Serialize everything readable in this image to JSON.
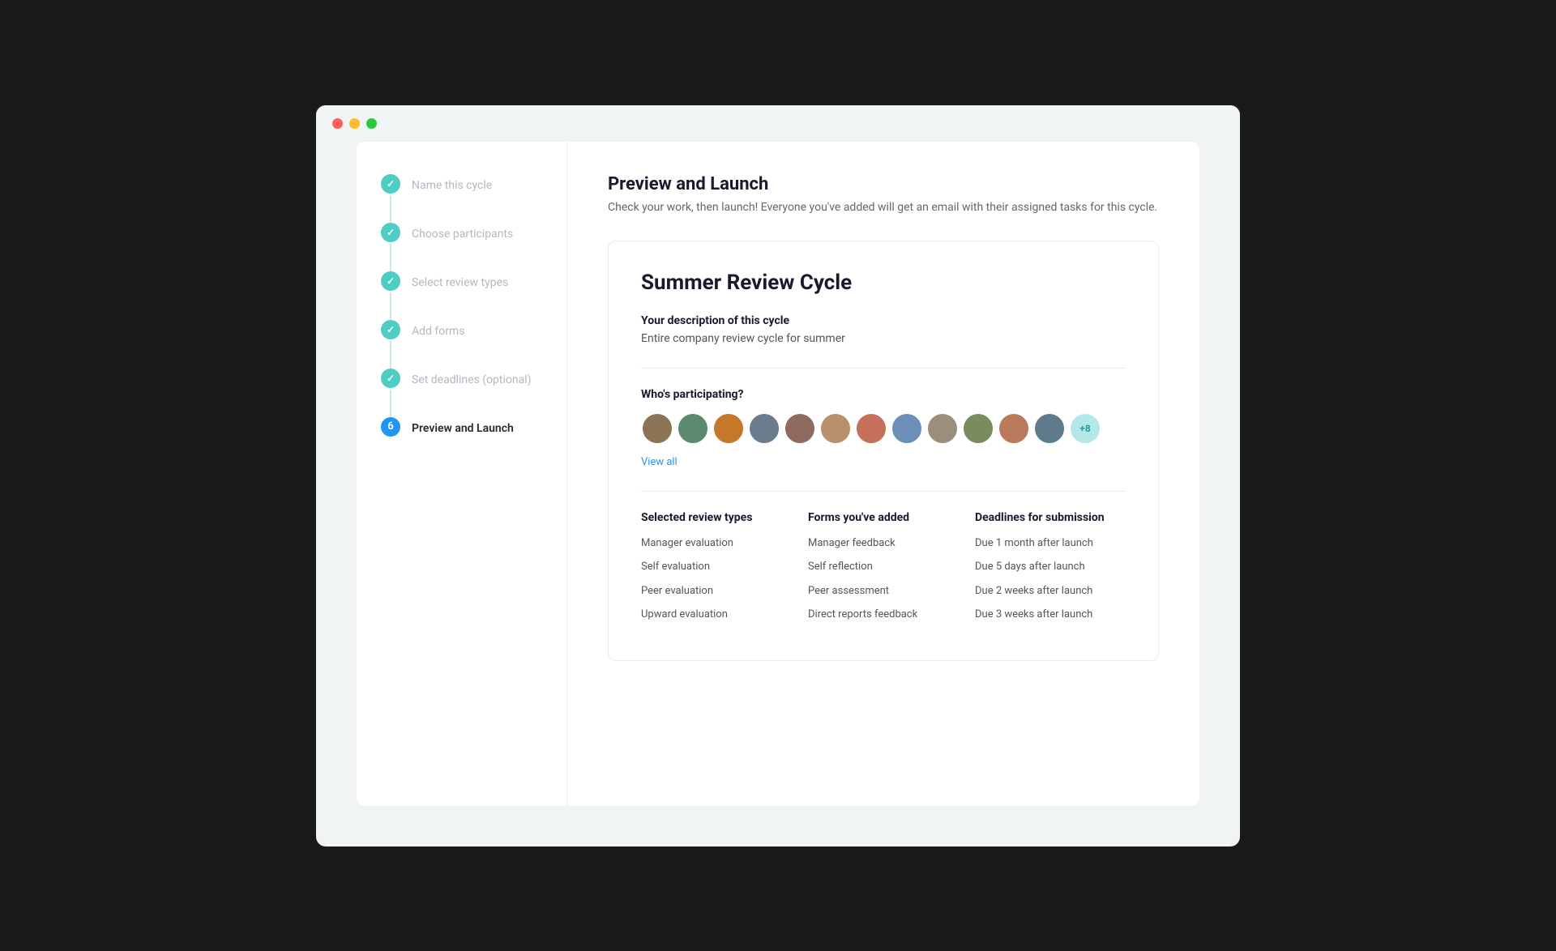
{
  "titlebar": {
    "buttons": [
      "close",
      "minimize",
      "maximize"
    ]
  },
  "sidebar": {
    "steps": [
      {
        "id": 1,
        "label": "Name this cycle",
        "status": "completed",
        "number": "✓"
      },
      {
        "id": 2,
        "label": "Choose participants",
        "status": "completed",
        "number": "✓"
      },
      {
        "id": 3,
        "label": "Select review types",
        "status": "completed",
        "number": "✓"
      },
      {
        "id": 4,
        "label": "Add forms",
        "status": "completed",
        "number": "✓"
      },
      {
        "id": 5,
        "label": "Set deadlines (optional)",
        "status": "completed",
        "number": "✓"
      },
      {
        "id": 6,
        "label": "Preview and Launch",
        "status": "active",
        "number": "6"
      }
    ]
  },
  "main": {
    "page_title": "Preview and Launch",
    "page_subtitle": "Check your work, then launch! Everyone you've added will get an email with their assigned tasks for this cycle.",
    "cycle_title": "Summer Review Cycle",
    "description_label": "Your description of this cycle",
    "description_text": "Entire company review cycle for summer",
    "participating_label": "Who's participating?",
    "view_all_label": "View all",
    "plus_count": "+8",
    "review_types": {
      "header": "Selected review types",
      "items": [
        "Manager evaluation",
        "Self evaluation",
        "Peer evaluation",
        "Upward evaluation"
      ]
    },
    "forms": {
      "header": "Forms you've added",
      "items": [
        "Manager feedback",
        "Self reflection",
        "Peer assessment",
        "Direct reports feedback"
      ]
    },
    "deadlines": {
      "header": "Deadlines for submission",
      "items": [
        "Due 1 month after launch",
        "Due 5 days after launch",
        "Due 2 weeks after launch",
        "Due 3 weeks after launch"
      ]
    }
  }
}
